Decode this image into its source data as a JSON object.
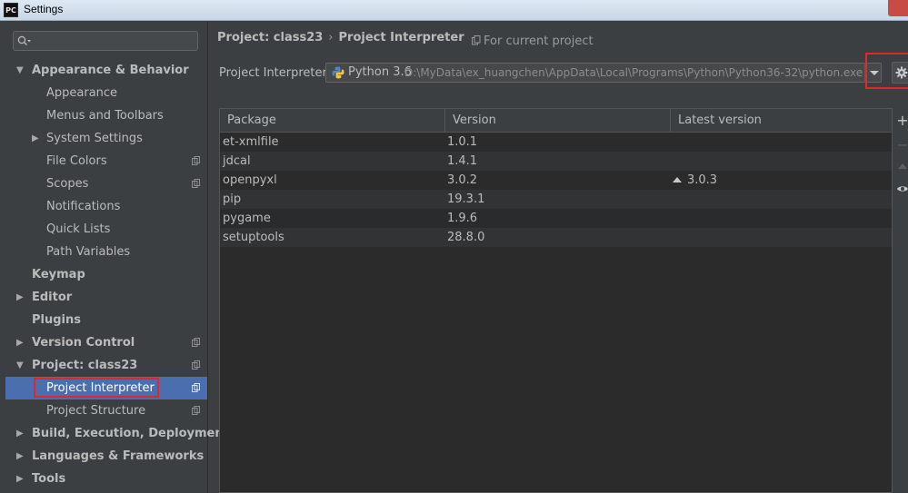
{
  "window": {
    "title": "Settings",
    "app_icon_text": "PC"
  },
  "search": {
    "placeholder": ""
  },
  "sidebar": {
    "items": [
      {
        "label": "Appearance & Behavior",
        "level": 0,
        "bold": true,
        "arrow": "expanded",
        "copy": false
      },
      {
        "label": "Appearance",
        "level": 1,
        "bold": false,
        "arrow": "none",
        "copy": false
      },
      {
        "label": "Menus and Toolbars",
        "level": 1,
        "bold": false,
        "arrow": "none",
        "copy": false
      },
      {
        "label": "System Settings",
        "level": 1,
        "bold": false,
        "arrow": "collapsed",
        "copy": false
      },
      {
        "label": "File Colors",
        "level": 1,
        "bold": false,
        "arrow": "none",
        "copy": true
      },
      {
        "label": "Scopes",
        "level": 1,
        "bold": false,
        "arrow": "none",
        "copy": true
      },
      {
        "label": "Notifications",
        "level": 1,
        "bold": false,
        "arrow": "none",
        "copy": false
      },
      {
        "label": "Quick Lists",
        "level": 1,
        "bold": false,
        "arrow": "none",
        "copy": false
      },
      {
        "label": "Path Variables",
        "level": 1,
        "bold": false,
        "arrow": "none",
        "copy": false
      },
      {
        "label": "Keymap",
        "level": 0,
        "bold": true,
        "arrow": "none",
        "copy": false
      },
      {
        "label": "Editor",
        "level": 0,
        "bold": true,
        "arrow": "collapsed",
        "copy": false
      },
      {
        "label": "Plugins",
        "level": 0,
        "bold": true,
        "arrow": "none",
        "copy": false
      },
      {
        "label": "Version Control",
        "level": 0,
        "bold": true,
        "arrow": "collapsed",
        "copy": true
      },
      {
        "label": "Project: class23",
        "level": 0,
        "bold": true,
        "arrow": "expanded",
        "copy": true
      },
      {
        "label": "Project Interpreter",
        "level": 1,
        "bold": false,
        "arrow": "none",
        "copy": true,
        "selected": true
      },
      {
        "label": "Project Structure",
        "level": 1,
        "bold": false,
        "arrow": "none",
        "copy": true
      },
      {
        "label": "Build, Execution, Deployment",
        "level": 0,
        "bold": true,
        "arrow": "collapsed",
        "copy": false
      },
      {
        "label": "Languages & Frameworks",
        "level": 0,
        "bold": true,
        "arrow": "collapsed",
        "copy": false
      },
      {
        "label": "Tools",
        "level": 0,
        "bold": true,
        "arrow": "collapsed",
        "copy": false
      }
    ]
  },
  "breadcrumb": {
    "project": "Project: class23",
    "separator": "›",
    "page": "Project Interpreter"
  },
  "scope_note": "For current project",
  "interpreter": {
    "label": "Project Interpreter:",
    "name": "Python 3.6",
    "path": "D:\\MyData\\ex_huangchen\\AppData\\Local\\Programs\\Python\\Python36-32\\python.exe"
  },
  "packages": {
    "columns": [
      "Package",
      "Version",
      "Latest version"
    ],
    "rows": [
      {
        "package": "et-xmlfile",
        "version": "1.0.1",
        "latest": ""
      },
      {
        "package": "jdcal",
        "version": "1.4.1",
        "latest": ""
      },
      {
        "package": "openpyxl",
        "version": "3.0.2",
        "latest": "3.0.3",
        "upgrade": true
      },
      {
        "package": "pip",
        "version": "19.3.1",
        "latest": ""
      },
      {
        "package": "pygame",
        "version": "1.9.6",
        "latest": ""
      },
      {
        "package": "setuptools",
        "version": "28.8.0",
        "latest": ""
      }
    ]
  },
  "colors": {
    "background": "#3c3f41",
    "selection": "#4b6eaf",
    "highlight_box": "#e0272b",
    "table_bg": "#2b2b2b"
  },
  "icons": {
    "search": "search-icon",
    "gear": "gear-icon",
    "dropdown": "chevron-down-icon",
    "python": "python-icon",
    "copy": "project-scope-icon",
    "add": "plus-icon",
    "remove": "minus-icon",
    "upgrade": "upgrade-arrow-icon",
    "eye": "eye-icon"
  }
}
